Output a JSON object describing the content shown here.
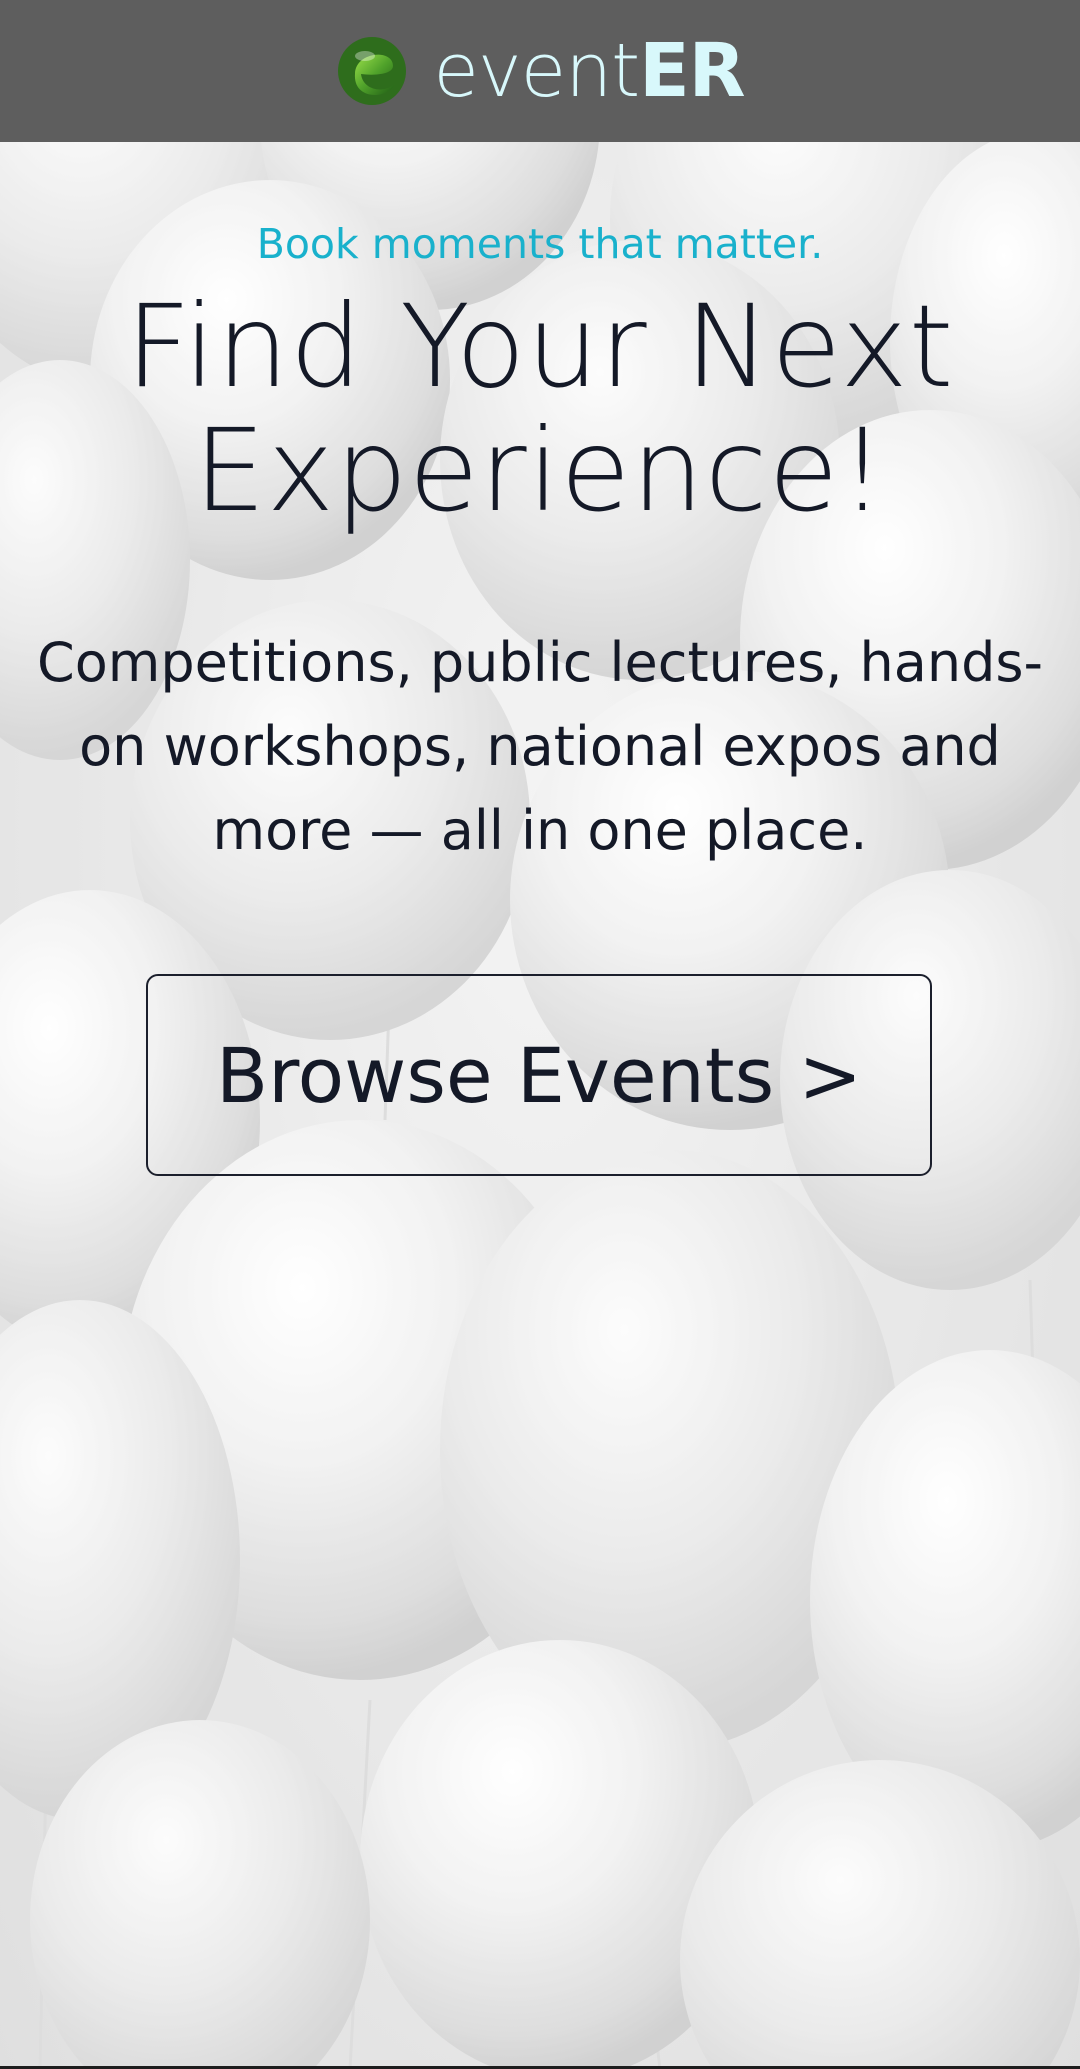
{
  "header": {
    "logo_icon": "eventer-logo-icon",
    "brand_light": "event",
    "brand_bold": "ER",
    "background_color": "#5e5e5e",
    "brand_color": "#d8f8fb"
  },
  "hero": {
    "tagline": "Book moments that matter.",
    "headline_line1": "Find Your Next",
    "headline_line2": "Experience!",
    "description_line1": "Competitions, public lectures, hands-",
    "description_line2": "on workshops, national expos and",
    "description_line3": "more — all in one place.",
    "cta_label": "Browse Events >",
    "accent_color": "#19b1cc",
    "text_color": "#141927"
  },
  "background": {
    "image": "balloons-background"
  }
}
